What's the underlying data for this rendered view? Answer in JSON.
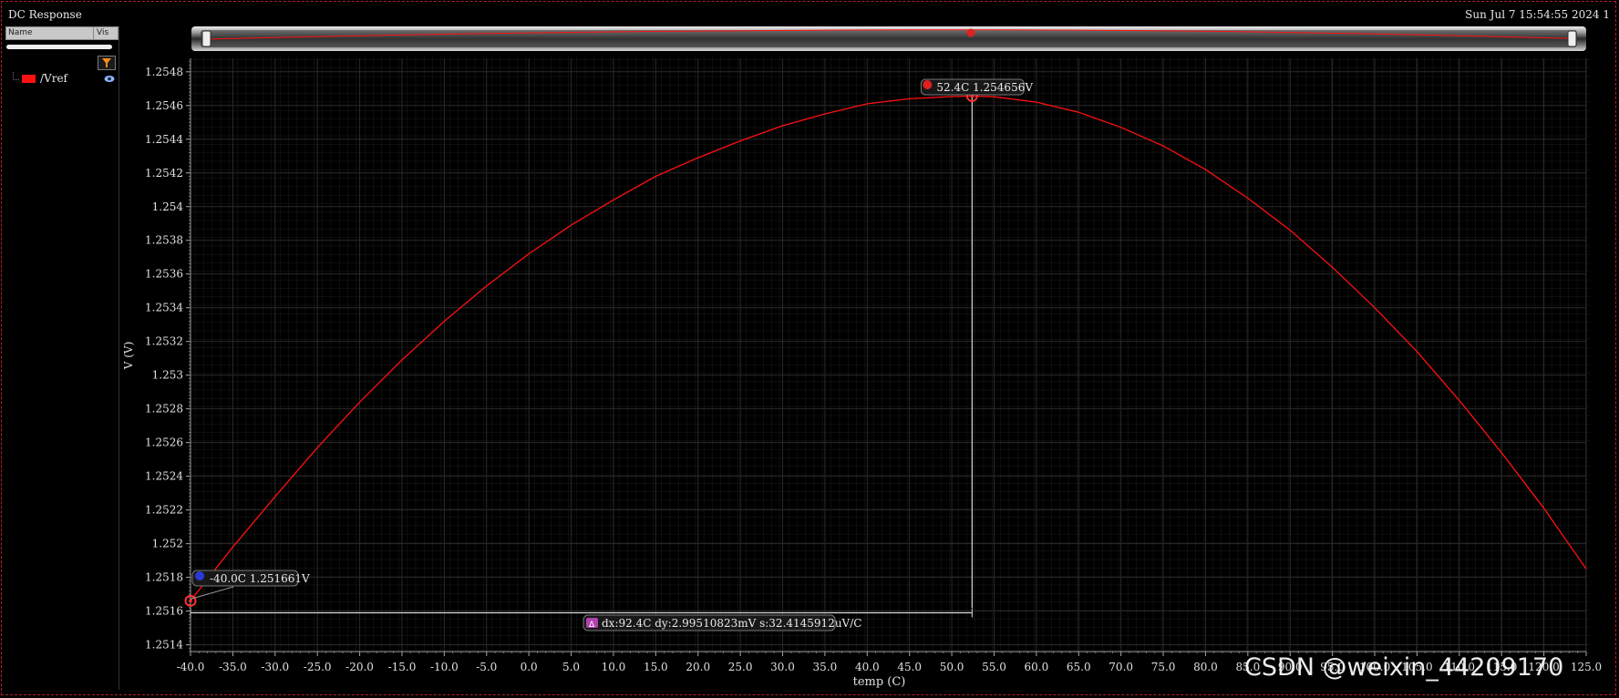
{
  "window": {
    "title": "DC Response",
    "timestamp": "Sun Jul 7 15:54:55 2024  1"
  },
  "legend": {
    "col_name": "Name",
    "col_vis": "Vis",
    "signals": [
      {
        "name": "/Vref",
        "color": "#ff1010"
      }
    ]
  },
  "chart_data": {
    "type": "line",
    "xlabel": "temp (C)",
    "ylabel": "V (V)",
    "xlim": [
      -40,
      125
    ],
    "ylim": [
      1.25136,
      1.25488
    ],
    "x_ticks": [
      -40,
      -35,
      -30,
      -25,
      -20,
      -15,
      -10,
      -5,
      0,
      5,
      10,
      15,
      20,
      25,
      30,
      35,
      40,
      45,
      50,
      55,
      60,
      65,
      70,
      75,
      80,
      85,
      90,
      95,
      100,
      105,
      110,
      115,
      120,
      125
    ],
    "x_tick_labels": [
      "-40.0",
      "-35.0",
      "-30.0",
      "-25.0",
      "-20.0",
      "-15.0",
      "-10.0",
      "-5.0",
      "0.0",
      "5.0",
      "10.0",
      "15.0",
      "20.0",
      "25.0",
      "30.0",
      "35.0",
      "40.0",
      "45.0",
      "50.0",
      "55.0",
      "60.0",
      "65.0",
      "70.0",
      "75.0",
      "80.0",
      "85.0",
      "90.0",
      "95.0",
      "100.0",
      "105.0",
      "110.0",
      "115.0",
      "120.0",
      "125.0"
    ],
    "y_ticks": [
      1.2514,
      1.2516,
      1.2518,
      1.252,
      1.2522,
      1.2524,
      1.2526,
      1.2528,
      1.253,
      1.2532,
      1.2534,
      1.2536,
      1.2538,
      1.254,
      1.2542,
      1.2544,
      1.2546,
      1.2548
    ],
    "y_tick_labels": [
      "1.2514",
      "1.2516",
      "1.2518",
      "1.252",
      "1.2522",
      "1.2524",
      "1.2526",
      "1.2528",
      "1.253",
      "1.2532",
      "1.2534",
      "1.2536",
      "1.2538",
      "1.254",
      "1.2542",
      "1.2544",
      "1.2546",
      "1.2548"
    ],
    "grid": true,
    "series": [
      {
        "name": "/Vref",
        "color": "#ff1010",
        "x": [
          -40,
          -35,
          -30,
          -25,
          -20,
          -15,
          -10,
          -5,
          0,
          5,
          10,
          15,
          20,
          25,
          30,
          35,
          40,
          45,
          50,
          52.4,
          55,
          60,
          65,
          70,
          75,
          80,
          85,
          90,
          95,
          100,
          105,
          110,
          115,
          120,
          125
        ],
        "y": [
          1.251661,
          1.25198,
          1.25228,
          1.25257,
          1.25284,
          1.25309,
          1.25332,
          1.25353,
          1.25372,
          1.25389,
          1.25404,
          1.25418,
          1.25429,
          1.25439,
          1.25448,
          1.25455,
          1.25461,
          1.25464,
          1.254653,
          1.254656,
          1.254652,
          1.25462,
          1.25456,
          1.25447,
          1.25436,
          1.25422,
          1.25405,
          1.25386,
          1.25364,
          1.2534,
          1.25314,
          1.25285,
          1.25254,
          1.25221,
          1.25185
        ]
      }
    ],
    "markers": [
      {
        "id": "A",
        "x": 52.4,
        "y": 1.254656,
        "label": "52.4C 1.254656V",
        "color": "#e02020"
      },
      {
        "id": "B",
        "x": -40.0,
        "y": 1.251661,
        "label": "-40.0C 1.251661V",
        "color": "#2a3ad8"
      }
    ],
    "delta": {
      "symbol": "Δ",
      "label": "dx:92.4C dy:2.99510823mV s:32.4145912uV/C",
      "y": 1.25159
    }
  },
  "watermark": "CSDN @weixin_44209170"
}
